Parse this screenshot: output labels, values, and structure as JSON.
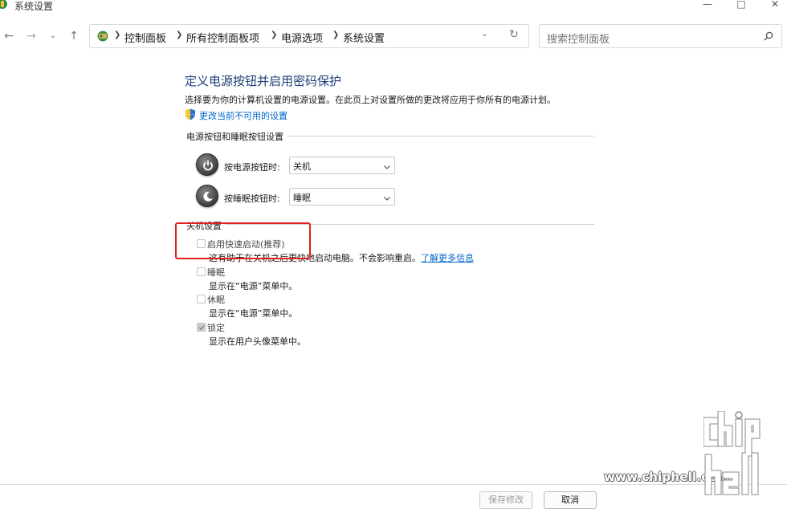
{
  "window": {
    "title": "系统设置",
    "minimize_icon": "minimize-icon",
    "maximize_icon": "maximize-icon",
    "close_icon": "close-icon"
  },
  "nav": {
    "back_icon": "arrow-left-icon",
    "forward_icon": "arrow-right-icon",
    "recent_icon": "chevron-down-icon",
    "up_icon": "arrow-up-icon",
    "breadcrumbs": [
      "控制面板",
      "所有控制面板项",
      "电源选项",
      "系统设置"
    ],
    "refresh_icon": "refresh-icon"
  },
  "search": {
    "placeholder": "搜索控制面板"
  },
  "main": {
    "title": "定义电源按钮并启用密码保护",
    "description": "选择要为你的计算机设置的电源设置。在此页上对设置所做的更改将应用于你所有的电源计划。",
    "change_link": "更改当前不可用的设置",
    "buttons_section": {
      "heading": "电源按钮和睡眠按钮设置",
      "power_label": "按电源按钮时:",
      "power_value": "关机",
      "sleep_label": "按睡眠按钮时:",
      "sleep_value": "睡眠"
    },
    "shutdown_section": {
      "heading": "关机设置",
      "fast_startup": {
        "label": "启用快速启动(推荐)",
        "desc": "这有助于在关机之后更快地启动电脑。不会影响重启。",
        "link": "了解更多信息",
        "checked": false
      },
      "sleep": {
        "label": "睡眠",
        "desc": "显示在“电源”菜单中。",
        "checked": false
      },
      "hibernate": {
        "label": "休眠",
        "desc": "显示在“电源”菜单中。",
        "checked": false
      },
      "lock": {
        "label": "锁定",
        "desc": "显示在用户头像菜单中。",
        "checked": true
      }
    }
  },
  "footer": {
    "save_label": "保存修改",
    "cancel_label": "取消"
  },
  "watermark": {
    "url": "www.chiphell.com",
    "logo_text": "chip hell"
  },
  "colors": {
    "title_blue": "#1e3f7a",
    "link_blue": "#0066cc",
    "highlight_red": "#e02020"
  }
}
